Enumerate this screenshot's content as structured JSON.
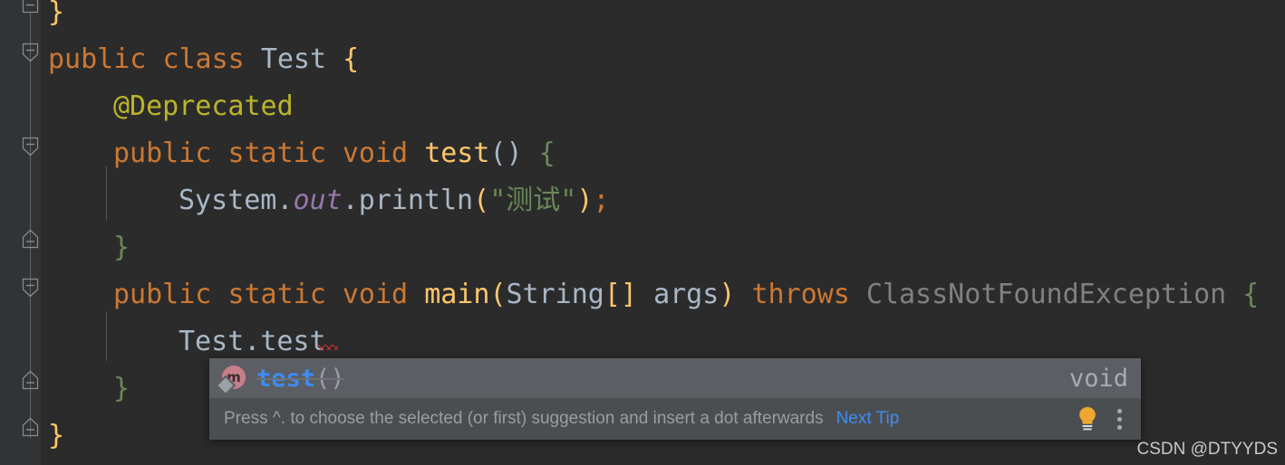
{
  "editor": {
    "background": "#2b2b2b",
    "gutter_background": "#313335",
    "current_line_background": "#323232",
    "lines": [
      {
        "id": "line-close-brace-top",
        "indent": 0,
        "tokens": [
          {
            "t": "}",
            "c": "brace-y"
          }
        ]
      },
      {
        "id": "line-class-decl",
        "indent": 0,
        "tokens": [
          {
            "t": "public",
            "c": "kw"
          },
          {
            "t": " ",
            "c": "plain"
          },
          {
            "t": "class",
            "c": "kw"
          },
          {
            "t": " ",
            "c": "plain"
          },
          {
            "t": "Test",
            "c": "cls"
          },
          {
            "t": " ",
            "c": "plain"
          },
          {
            "t": "{",
            "c": "brace-y"
          }
        ]
      },
      {
        "id": "line-deprecated-annotation",
        "indent": 1,
        "tokens": [
          {
            "t": "@Deprecated",
            "c": "anno"
          }
        ]
      },
      {
        "id": "line-test-method-decl",
        "indent": 1,
        "tokens": [
          {
            "t": "public",
            "c": "kw"
          },
          {
            "t": " ",
            "c": "plain"
          },
          {
            "t": "static",
            "c": "kw"
          },
          {
            "t": " ",
            "c": "plain"
          },
          {
            "t": "void",
            "c": "kw"
          },
          {
            "t": " ",
            "c": "plain"
          },
          {
            "t": "test",
            "c": "mth"
          },
          {
            "t": "()",
            "c": "plain"
          },
          {
            "t": " ",
            "c": "plain"
          },
          {
            "t": "{",
            "c": "brace-g"
          }
        ]
      },
      {
        "id": "line-println",
        "indent": 2,
        "tokens": [
          {
            "t": "System",
            "c": "cls"
          },
          {
            "t": ".",
            "c": "plain"
          },
          {
            "t": "out",
            "c": "field"
          },
          {
            "t": ".",
            "c": "plain"
          },
          {
            "t": "println",
            "c": "plain"
          },
          {
            "t": "(",
            "c": "strq"
          },
          {
            "t": "\"",
            "c": "str"
          },
          {
            "t": "测试",
            "c": "str"
          },
          {
            "t": "\"",
            "c": "str"
          },
          {
            "t": ")",
            "c": "strq"
          },
          {
            "t": ";",
            "c": "semi"
          }
        ]
      },
      {
        "id": "line-test-method-close",
        "indent": 1,
        "tokens": [
          {
            "t": "}",
            "c": "brace-g"
          }
        ]
      },
      {
        "id": "line-main-decl",
        "indent": 1,
        "tokens": [
          {
            "t": "public",
            "c": "kw"
          },
          {
            "t": " ",
            "c": "plain"
          },
          {
            "t": "static",
            "c": "kw"
          },
          {
            "t": " ",
            "c": "plain"
          },
          {
            "t": "void",
            "c": "kw"
          },
          {
            "t": " ",
            "c": "plain"
          },
          {
            "t": "main",
            "c": "mth"
          },
          {
            "t": "(",
            "c": "strq"
          },
          {
            "t": "String",
            "c": "cls"
          },
          {
            "t": "[]",
            "c": "strq"
          },
          {
            "t": " ",
            "c": "plain"
          },
          {
            "t": "args",
            "c": "plain"
          },
          {
            "t": ")",
            "c": "strq"
          },
          {
            "t": " ",
            "c": "plain"
          },
          {
            "t": "throws",
            "c": "kw"
          },
          {
            "t": " ",
            "c": "plain"
          },
          {
            "t": "ClassNotFoundException",
            "c": "grey"
          },
          {
            "t": " ",
            "c": "plain"
          },
          {
            "t": "{",
            "c": "brace-g"
          }
        ]
      },
      {
        "id": "line-caret-Test-test",
        "indent": 2,
        "current": true,
        "tokens": [
          {
            "t": "Test",
            "c": "cls"
          },
          {
            "t": ".",
            "c": "plain"
          },
          {
            "t": "test",
            "c": "cls"
          }
        ]
      },
      {
        "id": "line-main-close",
        "indent": 1,
        "tokens": [
          {
            "t": "}",
            "c": "brace-g"
          }
        ]
      },
      {
        "id": "line-class-close",
        "indent": 0,
        "tokens": [
          {
            "t": "}",
            "c": "brace-y"
          }
        ]
      }
    ]
  },
  "completion_popup": {
    "selected_item": {
      "icon_name": "method-icon",
      "icon_letter": "m",
      "icon_color": "#c77e8a",
      "name": "test",
      "params": "()",
      "deprecated": true,
      "return_type": "void"
    },
    "hint": {
      "text": "Press ^. to choose the selected (or first) suggestion and insert a dot afterwards",
      "link_label": "Next Tip",
      "link_color": "#3f8cf5",
      "bulb_icon": "lightbulb-icon",
      "menu_icon": "kebab-menu-icon"
    }
  },
  "watermark": {
    "text": "CSDN @DTYYDS"
  }
}
